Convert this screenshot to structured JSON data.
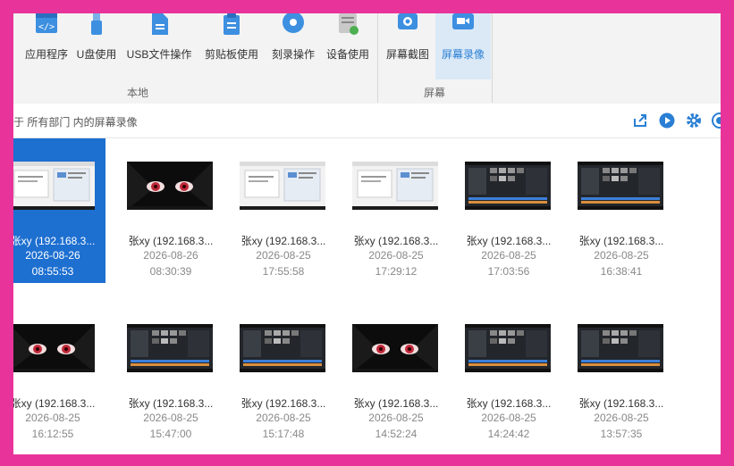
{
  "ribbon": {
    "buttons": [
      {
        "label": "应用程序",
        "icon": "code-window-icon"
      },
      {
        "label": "U盘使用",
        "icon": "usb-icon"
      },
      {
        "label": "USB文件操作",
        "icon": "file-icon"
      },
      {
        "label": "剪贴板使用",
        "icon": "clipboard-icon"
      },
      {
        "label": "刻录操作",
        "icon": "disc-icon"
      },
      {
        "label": "设备使用",
        "icon": "device-icon"
      },
      {
        "label": "屏幕截图",
        "icon": "camera-icon"
      },
      {
        "label": "屏幕录像",
        "icon": "video-camera-icon"
      }
    ],
    "groups": [
      "本地",
      "屏幕"
    ]
  },
  "toolbar": {
    "path": "于 所有部门 内的屏幕录像"
  },
  "colors": {
    "accent": "#1d6fd0",
    "frame": "#e8339a",
    "icon_blue": "#3d8fe0"
  },
  "recordings": [
    {
      "name": "张xy (192.168.3...",
      "date": "2026-08-26",
      "time": "08:55:53",
      "thumb": "office",
      "selected": true
    },
    {
      "name": "张xy (192.168.3...",
      "date": "2026-08-26",
      "time": "08:30:39",
      "thumb": "anime",
      "selected": false
    },
    {
      "name": "张xy (192.168.3...",
      "date": "2026-08-25",
      "time": "17:55:58",
      "thumb": "office",
      "selected": false
    },
    {
      "name": "张xy (192.168.3...",
      "date": "2026-08-25",
      "time": "17:29:12",
      "thumb": "office",
      "selected": false
    },
    {
      "name": "张xy (192.168.3...",
      "date": "2026-08-25",
      "time": "17:03:56",
      "thumb": "dark",
      "selected": false
    },
    {
      "name": "张xy (192.168.3...",
      "date": "2026-08-25",
      "time": "16:38:41",
      "thumb": "dark",
      "selected": false
    },
    {
      "name": "张xy (192.168.3...",
      "date": "2026-08-25",
      "time": "16:12:55",
      "thumb": "anime",
      "selected": false
    },
    {
      "name": "张xy (192.168.3...",
      "date": "2026-08-25",
      "time": "15:47:00",
      "thumb": "dark",
      "selected": false
    },
    {
      "name": "张xy (192.168.3...",
      "date": "2026-08-25",
      "time": "15:17:48",
      "thumb": "dark",
      "selected": false
    },
    {
      "name": "张xy (192.168.3...",
      "date": "2026-08-25",
      "time": "14:52:24",
      "thumb": "anime",
      "selected": false
    },
    {
      "name": "张xy (192.168.3...",
      "date": "2026-08-25",
      "time": "14:24:42",
      "thumb": "dark",
      "selected": false
    },
    {
      "name": "张xy (192.168.3...",
      "date": "2026-08-25",
      "time": "13:57:35",
      "thumb": "dark",
      "selected": false
    }
  ]
}
